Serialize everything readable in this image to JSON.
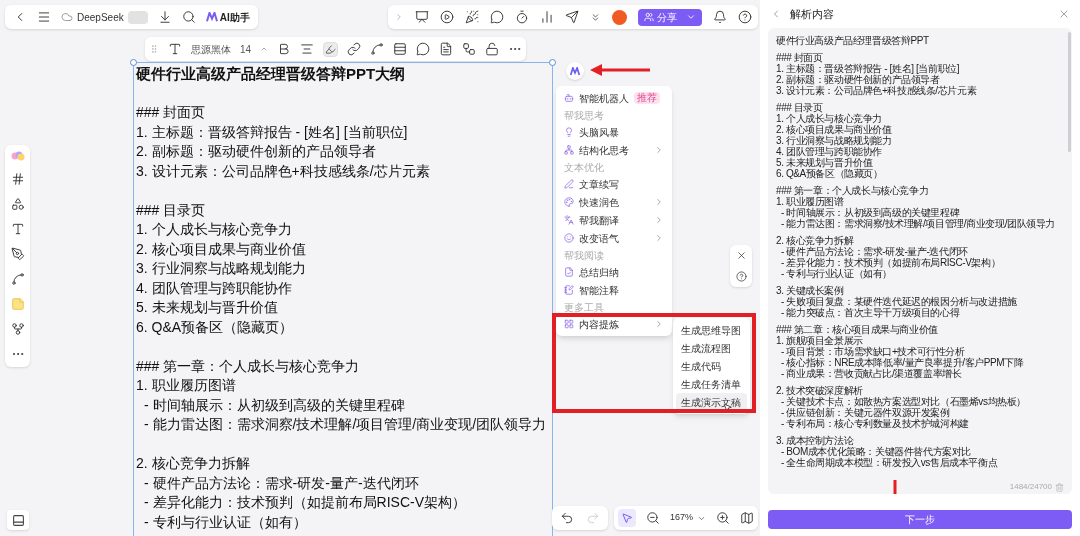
{
  "top_bar": {
    "file_name": "DeepSeek",
    "ai_button": "AI助手"
  },
  "share_button": {
    "label": "分享"
  },
  "format_toolbar": {
    "font": "思源黑体",
    "size": "14",
    "highlight_selected": true
  },
  "document": {
    "title": "硬件行业高级产品经理晋级答辩PPT大纲",
    "blocks": [
      {
        "lines": [
          {
            "text": "### 封面页"
          },
          {
            "text": "1. 主标题：晋级答辩报告 - [姓名] [当前职位]"
          },
          {
            "text": "2. 副标题：驱动硬件创新的产品领导者"
          },
          {
            "text": "3. 设计元素：公司品牌色+科技感线条/芯片元素"
          }
        ]
      },
      {
        "lines": [
          {
            "text": "### 目录页"
          },
          {
            "text": "1. 个人成长与核心竞争力"
          },
          {
            "text": "2. 核心项目成果与商业价值"
          },
          {
            "text": "3. 行业洞察与战略规划能力"
          },
          {
            "text": "4. 团队管理与跨职能协作"
          },
          {
            "text": "5. 未来规划与晋升价值"
          },
          {
            "text": "6. Q&A预备区（隐藏页）"
          }
        ]
      },
      {
        "lines": [
          {
            "text": "### 第一章：个人成长与核心竞争力"
          },
          {
            "text": "1. 职业履历图谱",
            "children": [
              "- 时间轴展示：从初级到高级的关键里程碑",
              "- 能力雷达图：需求洞察/技术理解/项目管理/商业变现/团队领导力"
            ]
          }
        ]
      },
      {
        "lines": [
          {
            "text": "2. 核心竞争力拆解",
            "children": [
              "- 硬件产品方法论：需求-研发-量产-迭代闭环",
              "- 差异化能力：技术预判（如提前布局RISC-V架构）",
              "- 专利与行业认证（如有）"
            ]
          }
        ]
      }
    ]
  },
  "ai_menu": [
    {
      "kind": "item",
      "label": "智能机器人",
      "badge": "推荐",
      "submenu": false
    },
    {
      "kind": "header",
      "label": "帮我思考"
    },
    {
      "kind": "item",
      "label": "头脑风暴",
      "submenu": false
    },
    {
      "kind": "item",
      "label": "结构化思考",
      "submenu": true
    },
    {
      "kind": "header",
      "label": "文本优化"
    },
    {
      "kind": "item",
      "label": "文章续写",
      "submenu": false
    },
    {
      "kind": "item",
      "label": "快速润色",
      "submenu": true
    },
    {
      "kind": "item",
      "label": "帮我翻译",
      "submenu": true
    },
    {
      "kind": "item",
      "label": "改变语气",
      "submenu": true
    },
    {
      "kind": "header",
      "label": "帮我阅读"
    },
    {
      "kind": "item",
      "label": "总结归纳",
      "submenu": false
    },
    {
      "kind": "item",
      "label": "智能注释",
      "submenu": false
    },
    {
      "kind": "header",
      "label": "更多工具"
    },
    {
      "kind": "item",
      "label": "内容提炼",
      "submenu": true
    }
  ],
  "submenu": [
    {
      "label": "生成思维导图",
      "selected": false
    },
    {
      "label": "生成流程图",
      "selected": false
    },
    {
      "label": "生成代码",
      "selected": false
    },
    {
      "label": "生成任务清单",
      "selected": false
    },
    {
      "label": "生成演示文稿",
      "selected": true
    }
  ],
  "bottom_toolbar": {
    "redo_disabled": true,
    "select_selected": true,
    "zoom": "167%"
  },
  "panel": {
    "title": "解析内容",
    "heading": "硬件行业高级产品经理晋级答辩PPT",
    "blocks": [
      {
        "lines": [
          {
            "text": "### 封面页"
          },
          {
            "text": "1. 主标题：晋级答辩报告 - [姓名] [当前职位]"
          },
          {
            "text": "2. 副标题：驱动硬件创新的产品领导者"
          },
          {
            "text": "3. 设计元素：公司品牌色+科技感线条/芯片元素"
          }
        ]
      },
      {
        "lines": [
          {
            "text": "### 目录页"
          },
          {
            "text": "1. 个人成长与核心竞争力"
          },
          {
            "text": "2. 核心项目成果与商业价值"
          },
          {
            "text": "3. 行业洞察与战略规划能力"
          },
          {
            "text": "4. 团队管理与跨职能协作"
          },
          {
            "text": "5. 未来规划与晋升价值"
          },
          {
            "text": "6. Q&A预备区（隐藏页）"
          }
        ]
      },
      {
        "lines": [
          {
            "text": "### 第一章：个人成长与核心竞争力"
          },
          {
            "text": "1. 职业履历图谱",
            "children": [
              "- 时间轴展示：从初级到高级的关键里程碑",
              "- 能力雷达图：需求洞察/技术理解/项目管理/商业变现/团队领导力"
            ]
          }
        ]
      },
      {
        "lines": [
          {
            "text": "2. 核心竞争力拆解",
            "children": [
              "- 硬件产品方法论：需求-研发-量产-迭代闭环",
              "- 差异化能力：技术预判（如提前布局RISC-V架构）",
              "- 专利与行业认证（如有）"
            ]
          }
        ]
      },
      {
        "lines": [
          {
            "text": "3. 关键成长案例",
            "children": [
              "- 失败项目复盘：某硬件迭代延迟的根因分析与改进措施",
              "- 能力突破点：首次主导千万级项目的心得"
            ]
          }
        ]
      },
      {
        "lines": [
          {
            "text": "### 第二章：核心项目成果与商业价值"
          },
          {
            "text": "1. 旗舰项目全景展示",
            "children": [
              "- 项目背景：市场需求缺口+技术可行性分析",
              "- 核心指标：NRE成本降低率/量产良率提升/客户PPM下降",
              "- 商业成果：营收贡献占比/渠道覆盖率增长"
            ]
          }
        ]
      },
      {
        "lines": [
          {
            "text": "2. 技术突破深度解析",
            "children": [
              "- 关键技术卡点：如散热方案选型对比（石墨烯vs均热板）",
              "- 供应链创新：关键元器件双源开发案例",
              "- 专利布局：核心专利数量及技术护城河构建"
            ]
          }
        ]
      },
      {
        "lines": [
          {
            "text": "3. 成本控制方法论",
            "children": [
              "- BOM成本优化策略：关键器件替代方案对比",
              "- 全生命周期成本模型：研发投入vs售后成本平衡点"
            ]
          }
        ]
      }
    ],
    "counter": "1484/24700",
    "button": "下一步"
  }
}
